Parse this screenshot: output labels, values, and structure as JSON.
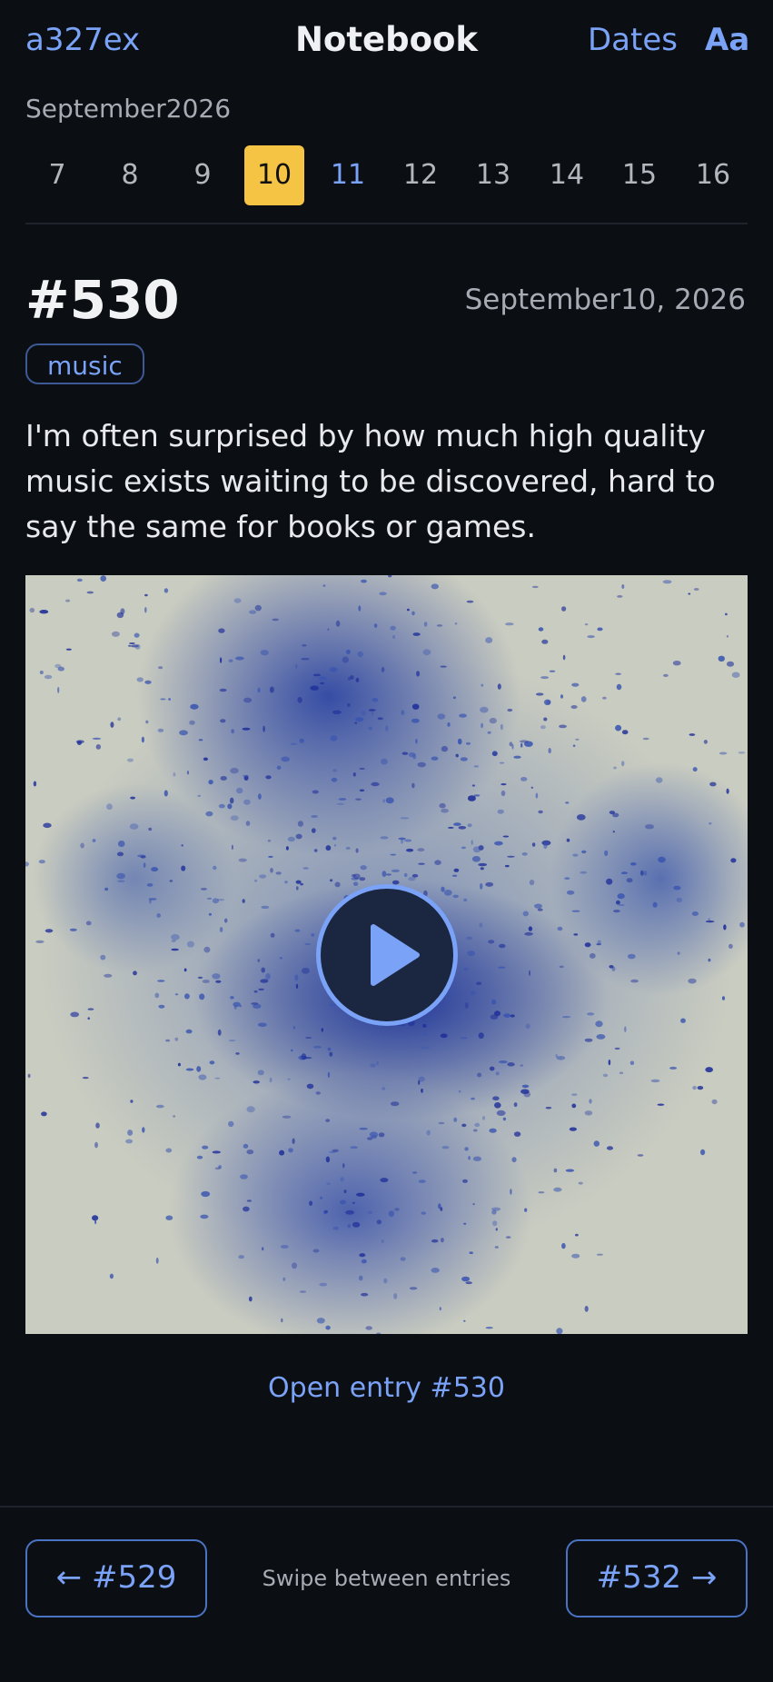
{
  "header": {
    "brand": "a327ex",
    "title": "Notebook",
    "dates_link": "Dates",
    "font_link": "Aa"
  },
  "calendar": {
    "month": "September2026",
    "days": [
      {
        "label": "7",
        "state": "plain"
      },
      {
        "label": "8",
        "state": "plain"
      },
      {
        "label": "9",
        "state": "plain"
      },
      {
        "label": "10",
        "state": "selected"
      },
      {
        "label": "11",
        "state": "has-entry"
      },
      {
        "label": "12",
        "state": "plain"
      },
      {
        "label": "13",
        "state": "plain"
      },
      {
        "label": "14",
        "state": "plain"
      },
      {
        "label": "15",
        "state": "plain"
      },
      {
        "label": "16",
        "state": "plain"
      }
    ]
  },
  "entry": {
    "number": "#530",
    "date": "September10, 2026",
    "tag": "music",
    "text": "I'm often surprised by how much high quality music exists waiting to be discovered, hard to say the same for books or games.",
    "media": {
      "type": "video",
      "icon": "play-icon"
    },
    "open_link": "Open entry #530"
  },
  "footer": {
    "prev_label": "← #529",
    "next_label": "#532 →",
    "hint": "Swipe between entries"
  },
  "colors": {
    "background": "#0b0e13",
    "accent": "#7aa2f7",
    "selected_day": "#f5c445",
    "text": "#e8e8ea",
    "muted": "#a7abb4"
  }
}
